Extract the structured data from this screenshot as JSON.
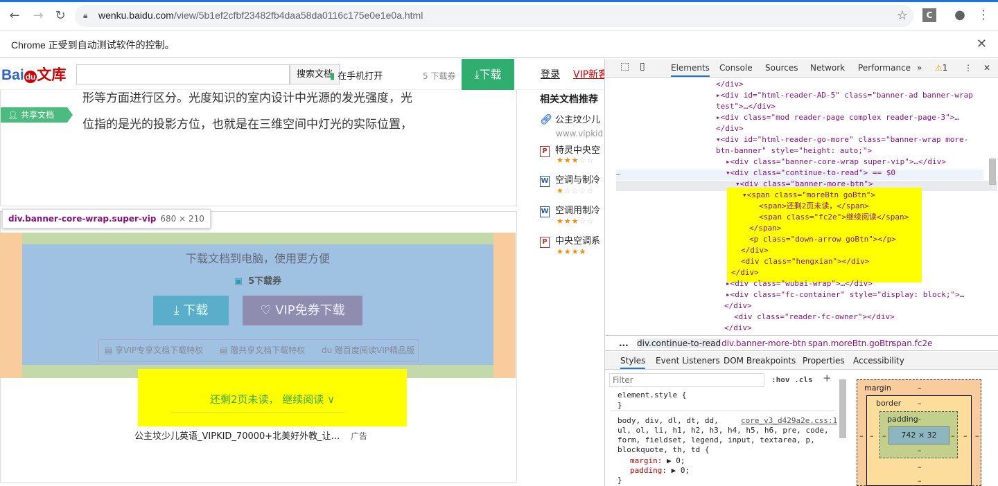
{
  "browser": {
    "url_host": "wenku.baidu.com",
    "url_path": "/view/5b1ef2cfbf23482fb4daa58da0116c175e0e1e0a.html",
    "profile_badge": "C",
    "infobar_text": "Chrome 正受到自动测试软件的控制。"
  },
  "site": {
    "logo_a": "Bai",
    "logo_b": "du",
    "logo_c": "文库",
    "search_button": "搜索文档",
    "mobile_open": "在手机打开",
    "quota": "5 下载券",
    "download": "下载",
    "login": "登录",
    "vip": "VIP新客"
  },
  "doc": {
    "line1": "形等方面进行区分。光度知识的室内设计中光源的发光强度，光",
    "line2": "位指的是光的投影方位，也就是在三维空间中灯光的实际位置，",
    "share_tag": "共享文档"
  },
  "tooltip": {
    "selector": "div.banner-core-wrap.super-vip",
    "size": "680 × 210"
  },
  "banner": {
    "title": "下载文档到电脑，使用更方便",
    "ticket": "5下载券",
    "download": "下载",
    "vip_download": "VIP免券下载",
    "features": [
      "享VIP专享文档下载特权",
      "赠共享文档下载特权",
      "赠百度阅读VIP精品版"
    ]
  },
  "continue": {
    "text": "还剩2页未读， 继续阅读",
    "chevron": "∨"
  },
  "ad": {
    "text": "公主坟少儿英语_VIPKID_70000+北美好外教_让...",
    "tag": "广告"
  },
  "related": {
    "title": "相关文档推荐",
    "items": [
      {
        "label": "公主坟少儿",
        "icon": "link-icon"
      },
      {
        "label": "特灵中央空",
        "icon": "ppt-icon",
        "stars": 3
      },
      {
        "label": "空调与制冷",
        "icon": "word-icon",
        "stars": 1.5
      },
      {
        "label": "空调用制冷",
        "icon": "word-icon",
        "stars": 2.5
      },
      {
        "label": "中央空调系",
        "icon": "ppt-icon",
        "stars": 4
      }
    ],
    "url": "www.vipkid"
  },
  "devtools": {
    "tabs": [
      "Elements",
      "Console",
      "Sources",
      "Network",
      "Performance"
    ],
    "warnings": "1",
    "crumbs": [
      "...",
      "div.continue-to-read",
      "div.banner-more-btn",
      "span.moreBtn.goBtn",
      "span.fc2e"
    ],
    "subtabs": [
      "Styles",
      "Event Listeners",
      "DOM Breakpoints",
      "Properties",
      "Accessibility"
    ],
    "filter_placeholder": "Filter",
    "hov": ":hov",
    "cls": ".cls",
    "element_style": "element.style {",
    "close_brace": "}",
    "css_source": "core_v3_d429a2e.css:1",
    "css_selector_1": "body, div, dl, dt, dd,",
    "css_selector_2": "ul, ol, li, h1, h2, h3, h4, h5, h6, pre, code,",
    "css_selector_3": "form, fieldset, legend, input, textarea, p,",
    "css_selector_4": "blockquote, th, td {",
    "prop_margin": "margin",
    "val_margin": ": ▶ 0;",
    "prop_padding": "padding",
    "val_padding": ": ▶ 0;",
    "box_margin": "margin",
    "box_border": "border",
    "box_padding": "padding-",
    "box_content": "742 × 32",
    "dash": "–"
  },
  "tree": [
    "</div>",
    "<div id=\"html-reader-AD-5\" class=\"banner-ad banner-wrap",
    "test\">…</div>",
    "<div class=\"mod reader-page complex reader-page-3\">…",
    "</div>",
    "<div id=\"html-reader-go-more\" class=\"banner-wrap more-",
    "btn-banner\" style=\"height: auto;\">",
    "<div class=\"banner-core-wrap super-vip\">…</div>",
    "<div class=\"continue-to-read\"> == $0",
    "<div class=\"banner-more-btn\">",
    "<span class=\"moreBtn goBtn\">",
    "<span>还剩2页未读，</span>",
    "<span class=\"fc2e\">继续阅读</span>",
    "</span>",
    "<p class=\"down-arrow goBtn\"></p>",
    "</div>",
    "<div class=\"hengxian\"></div>",
    "</div>",
    "<div class=\"wubai-wrap\">…</div>",
    "<div class=\"fc-container\" style=\"display: block;\">…",
    "</div>",
    "<div class=\"reader-fc-owner\"></div>",
    "</div>"
  ]
}
